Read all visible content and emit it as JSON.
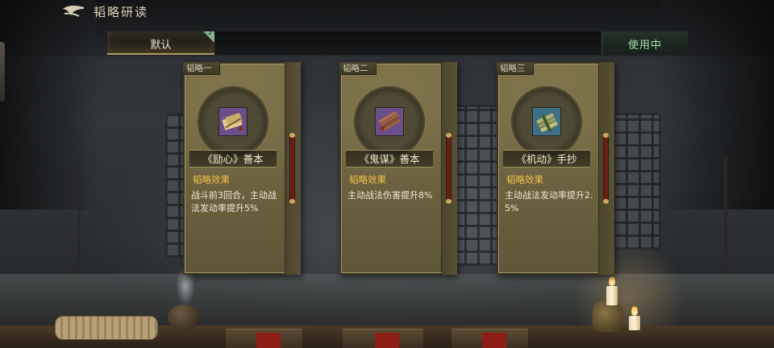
{
  "header": {
    "title": "韬略研读"
  },
  "tabbar": {
    "default_tab": "默认",
    "in_use_label": "使用中"
  },
  "cards": [
    {
      "tag": "韬略一",
      "name": "《励心》善本",
      "effect_heading": "韬略效果",
      "effect": "战斗前3回合，主动战法发动率提升5%",
      "icon": "scroll-bundle-icon"
    },
    {
      "tag": "韬略二",
      "name": "《鬼谋》善本",
      "effect_heading": "韬略效果",
      "effect": "主动战法伤害提升8%",
      "icon": "bamboo-slips-icon"
    },
    {
      "tag": "韬略三",
      "name": "《机动》手抄",
      "effect_heading": "韬略效果",
      "effect": "主动战法发动率提升2.5%",
      "icon": "bamboo-scroll-icon"
    }
  ],
  "colors": {
    "accent_gold": "#f2c04a",
    "in_use_green": "#9fe3a6"
  }
}
